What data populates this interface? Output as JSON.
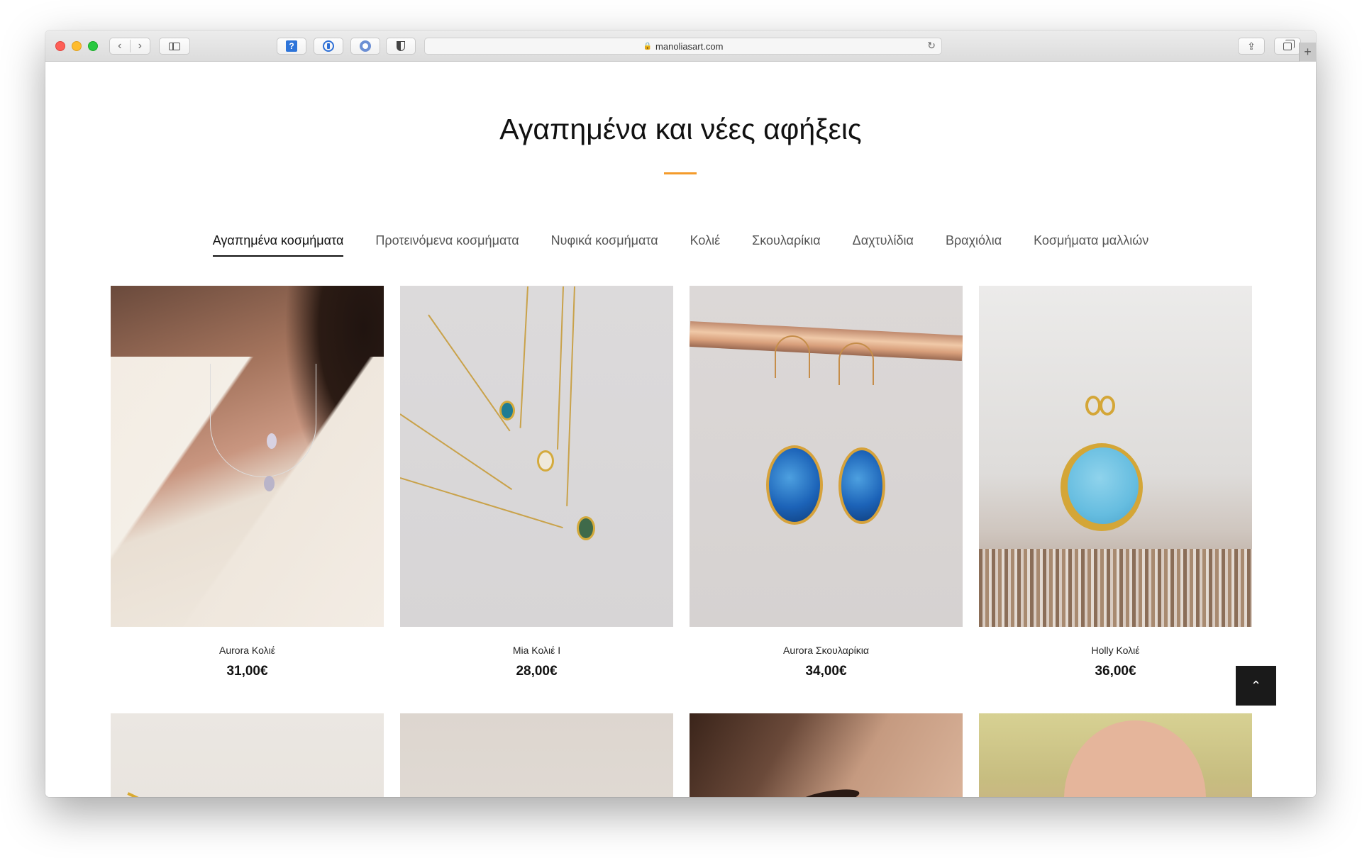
{
  "browser": {
    "url": "manoliasart.com",
    "lock_icon": "🔒",
    "reload_icon": "↻",
    "back_icon": "‹",
    "forward_icon": "›",
    "share_icon": "⇪",
    "new_tab_icon": "+"
  },
  "page": {
    "title": "Αγαπημένα και νέες αφήξεις",
    "accent_color": "#f49b2b"
  },
  "tabs": [
    {
      "label": "Αγαπημένα κοσμήματα",
      "active": true
    },
    {
      "label": "Προτεινόμενα κοσμήματα",
      "active": false
    },
    {
      "label": "Νυφικά κοσμήματα",
      "active": false
    },
    {
      "label": "Κολιέ",
      "active": false
    },
    {
      "label": "Σκουλαρίκια",
      "active": false
    },
    {
      "label": "Δαχτυλίδια",
      "active": false
    },
    {
      "label": "Βραχιόλια",
      "active": false
    },
    {
      "label": "Κοσμήματα μαλλιών",
      "active": false
    }
  ],
  "products": [
    {
      "name": "Aurora Κολιέ",
      "price": "31,00€"
    },
    {
      "name": "Mia Κολιέ I",
      "price": "28,00€"
    },
    {
      "name": "Aurora Σκουλαρίκια",
      "price": "34,00€"
    },
    {
      "name": "Holly Κολιέ",
      "price": "36,00€"
    }
  ],
  "back_to_top_icon": "⌃"
}
